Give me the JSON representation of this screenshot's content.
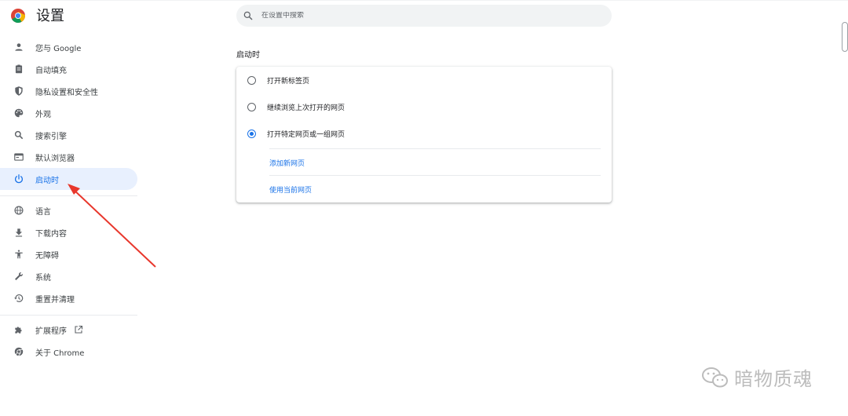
{
  "app": {
    "title": "设置"
  },
  "search": {
    "placeholder": "在设置中搜索"
  },
  "sidebar": {
    "items": [
      {
        "label": "您与 Google"
      },
      {
        "label": "自动填充"
      },
      {
        "label": "隐私设置和安全性"
      },
      {
        "label": "外观"
      },
      {
        "label": "搜索引擎"
      },
      {
        "label": "默认浏览器"
      },
      {
        "label": "启动时"
      },
      {
        "label": "语言"
      },
      {
        "label": "下载内容"
      },
      {
        "label": "无障碍"
      },
      {
        "label": "系统"
      },
      {
        "label": "重置并清理"
      },
      {
        "label": "扩展程序"
      },
      {
        "label": "关于 Chrome"
      }
    ],
    "active": "启动时"
  },
  "main": {
    "section_title": "启动时",
    "options": [
      {
        "label": "打开新标签页",
        "checked": false
      },
      {
        "label": "继续浏览上次打开的网页",
        "checked": false
      },
      {
        "label": "打开特定网页或一组网页",
        "checked": true
      }
    ],
    "links": {
      "add_page": "添加新网页",
      "use_current": "使用当前网页"
    }
  },
  "annotation": {
    "arrow_color": "#e8372c"
  },
  "watermark": {
    "text": "暗物质魂"
  },
  "colors": {
    "accent": "#1a73e8",
    "active_bg": "#e8f0fe"
  }
}
